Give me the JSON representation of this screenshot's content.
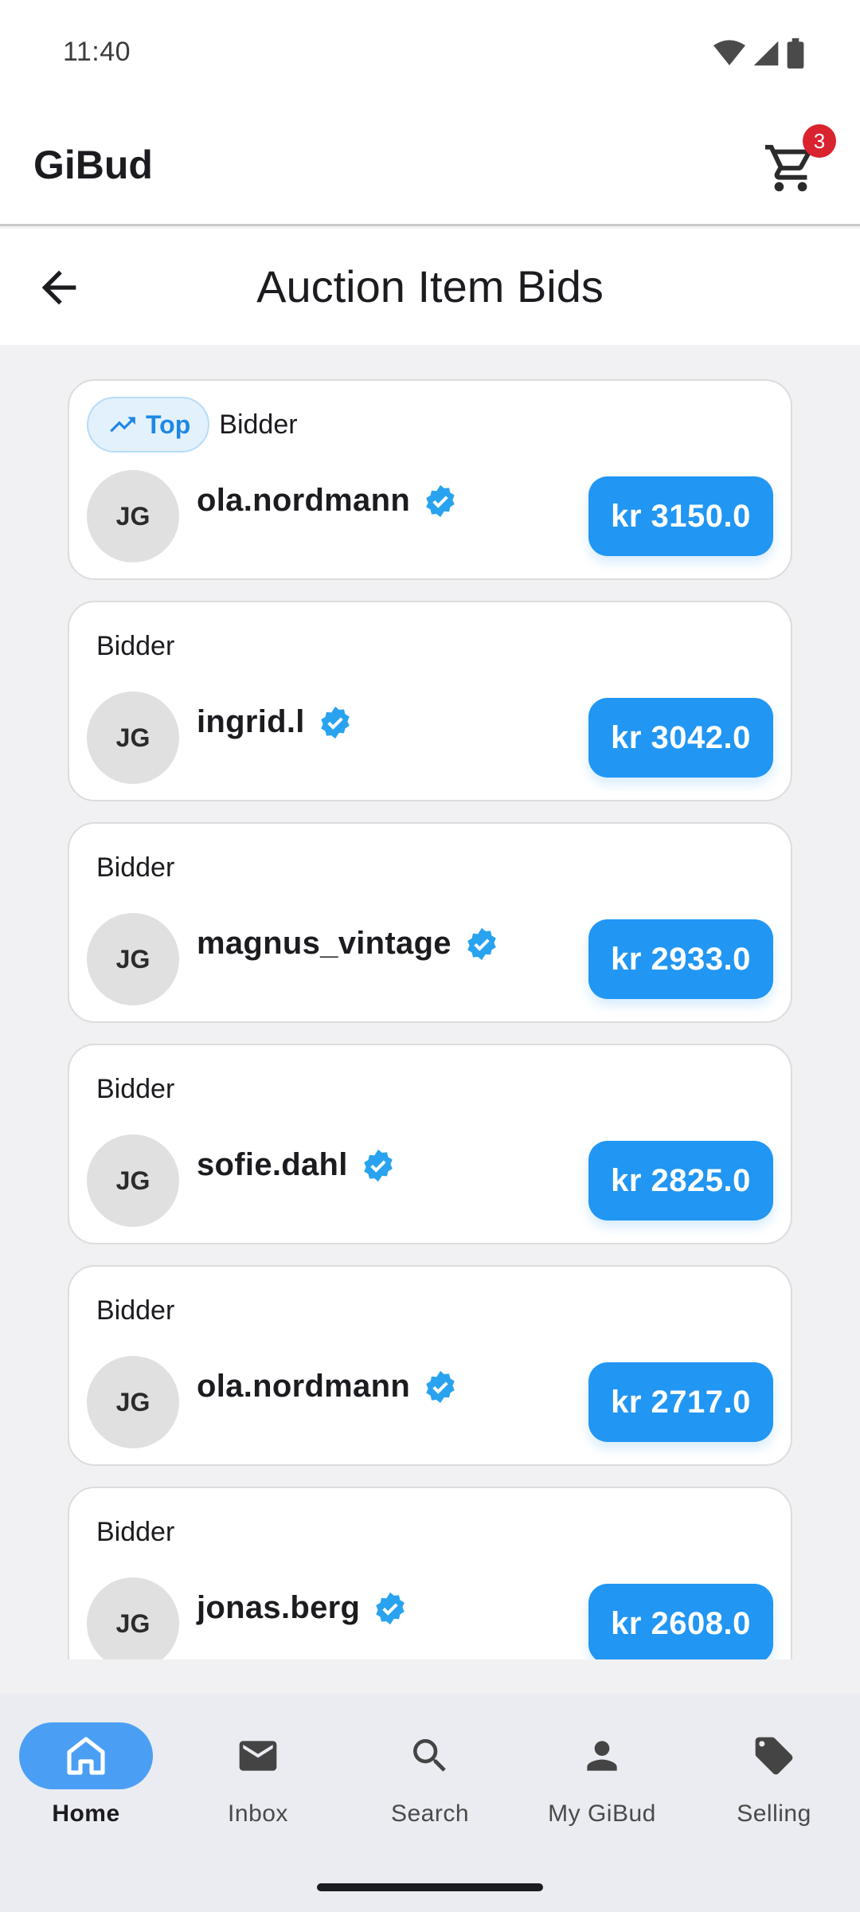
{
  "status_bar": {
    "time": "11:40"
  },
  "app_bar": {
    "title": "GiBud",
    "cart_count": "3"
  },
  "sub_header": {
    "title": "Auction Item Bids"
  },
  "top_badge": {
    "label": "Top"
  },
  "bids": [
    {
      "label": "Bidder",
      "initials": "JG",
      "username": "ola.nordmann",
      "amount": "kr 3150.0"
    },
    {
      "label": "Bidder",
      "initials": "JG",
      "username": "ingrid.l",
      "amount": "kr 3042.0"
    },
    {
      "label": "Bidder",
      "initials": "JG",
      "username": "magnus_vintage",
      "amount": "kr 2933.0"
    },
    {
      "label": "Bidder",
      "initials": "JG",
      "username": "sofie.dahl",
      "amount": "kr 2825.0"
    },
    {
      "label": "Bidder",
      "initials": "JG",
      "username": "ola.nordmann",
      "amount": "kr 2717.0"
    },
    {
      "label": "Bidder",
      "initials": "JG",
      "username": "jonas.berg",
      "amount": "kr 2608.0"
    }
  ],
  "bottom_nav": [
    {
      "label": "Home",
      "icon": "home-icon",
      "active": true
    },
    {
      "label": "Inbox",
      "icon": "mail-icon",
      "active": false
    },
    {
      "label": "Search",
      "icon": "search-icon",
      "active": false
    },
    {
      "label": "My GiBud",
      "icon": "person-icon",
      "active": false
    },
    {
      "label": "Selling",
      "icon": "tag-icon",
      "active": false
    }
  ],
  "colors": {
    "accent": "#2196f3",
    "badge": "#d9232f",
    "verified": "#29a3ef"
  }
}
